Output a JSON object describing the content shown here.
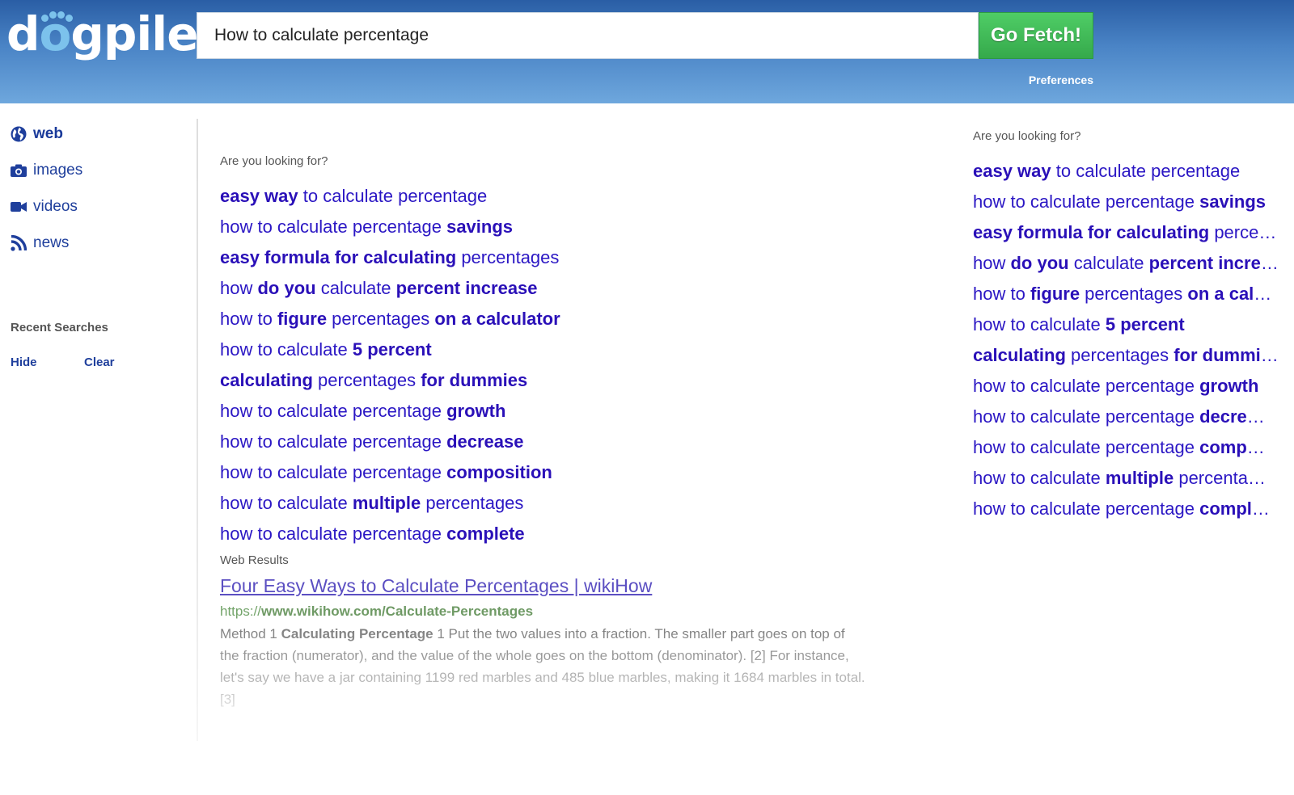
{
  "header": {
    "logo": "dogpile",
    "search_value": "How to calculate percentage",
    "search_button": "Go Fetch!",
    "preferences": "Preferences"
  },
  "sidebar": {
    "items": [
      {
        "label": "web",
        "icon": "globe-icon",
        "active": true
      },
      {
        "label": "images",
        "icon": "camera-icon",
        "active": false
      },
      {
        "label": "videos",
        "icon": "video-camera-icon",
        "active": false
      },
      {
        "label": "news",
        "icon": "rss-icon",
        "active": false
      }
    ],
    "recent_title": "Recent Searches",
    "hide": "Hide",
    "clear": "Clear"
  },
  "main": {
    "suggest_label": "Are you looking for?",
    "suggestions": [
      [
        [
          "easy way",
          true
        ],
        [
          " to calculate percentage",
          false
        ]
      ],
      [
        [
          "how to calculate percentage ",
          false
        ],
        [
          "savings",
          true
        ]
      ],
      [
        [
          "easy formula for calculating",
          true
        ],
        [
          " percentages",
          false
        ]
      ],
      [
        [
          "how ",
          false
        ],
        [
          "do you",
          true
        ],
        [
          " calculate ",
          false
        ],
        [
          "percent increase",
          true
        ]
      ],
      [
        [
          "how to ",
          false
        ],
        [
          "figure",
          true
        ],
        [
          " percentages ",
          false
        ],
        [
          "on a calculator",
          true
        ]
      ],
      [
        [
          "how to calculate ",
          false
        ],
        [
          "5 percent",
          true
        ]
      ],
      [
        [
          "calculating",
          true
        ],
        [
          " percentages ",
          false
        ],
        [
          "for dummies",
          true
        ]
      ],
      [
        [
          "how to calculate percentage ",
          false
        ],
        [
          "growth",
          true
        ]
      ],
      [
        [
          "how to calculate percentage ",
          false
        ],
        [
          "decrease",
          true
        ]
      ],
      [
        [
          "how to calculate percentage ",
          false
        ],
        [
          "composition",
          true
        ]
      ],
      [
        [
          "how to calculate ",
          false
        ],
        [
          "multiple",
          true
        ],
        [
          " percentages",
          false
        ]
      ],
      [
        [
          "how to calculate percentage ",
          false
        ],
        [
          "complete",
          true
        ]
      ]
    ],
    "web_results_label": "Web Results",
    "results": [
      {
        "title": "Four Easy Ways to Calculate Percentages | wikiHow",
        "url_prefix": "https://",
        "url_main": "www.wikihow.com/Calculate-Percentages",
        "snippet_prefix": "Method 1 ",
        "snippet_bold": "Calculating Percentage",
        "snippet_rest": " 1 Put the two values into a fraction. The smaller part goes on top of the fraction (numerator), and the value of the whole goes on the bottom (denominator). [2] For instance, let's say we have a jar containing 1199 red marbles and 485 blue marbles, making it 1684 marbles in total. [3]"
      }
    ]
  },
  "right": {
    "suggest_label": "Are you looking for?",
    "suggestions": [
      [
        [
          "easy way",
          true
        ],
        [
          " to calculate percentage",
          false
        ]
      ],
      [
        [
          "how to calculate percentage ",
          false
        ],
        [
          "savings",
          true
        ]
      ],
      [
        [
          "easy formula for calculating",
          true
        ],
        [
          " perce…",
          false
        ]
      ],
      [
        [
          "how ",
          false
        ],
        [
          "do you",
          true
        ],
        [
          " calculate ",
          false
        ],
        [
          "percent incre",
          true
        ],
        [
          "…",
          false
        ]
      ],
      [
        [
          "how to ",
          false
        ],
        [
          "figure",
          true
        ],
        [
          " percentages ",
          false
        ],
        [
          "on a cal",
          true
        ],
        [
          "…",
          false
        ]
      ],
      [
        [
          "how to calculate ",
          false
        ],
        [
          "5 percent",
          true
        ]
      ],
      [
        [
          "calculating",
          true
        ],
        [
          " percentages ",
          false
        ],
        [
          "for dummi",
          true
        ],
        [
          "…",
          false
        ]
      ],
      [
        [
          "how to calculate percentage ",
          false
        ],
        [
          "growth",
          true
        ]
      ],
      [
        [
          "how to calculate percentage ",
          false
        ],
        [
          "decre",
          true
        ],
        [
          "…",
          false
        ]
      ],
      [
        [
          "how to calculate percentage ",
          false
        ],
        [
          "comp",
          true
        ],
        [
          "…",
          false
        ]
      ],
      [
        [
          "how to calculate ",
          false
        ],
        [
          "multiple",
          true
        ],
        [
          " percenta…",
          false
        ]
      ],
      [
        [
          "how to calculate percentage ",
          false
        ],
        [
          "compl",
          true
        ],
        [
          "…",
          false
        ]
      ]
    ]
  },
  "colors": {
    "header_top": "#2a5ea5",
    "header_bottom": "#6ea7dd",
    "button_green": "#3cb554",
    "suggest_link": "#2b17c4",
    "nav_link": "#1f3f9c",
    "url_green": "#73a46a"
  }
}
